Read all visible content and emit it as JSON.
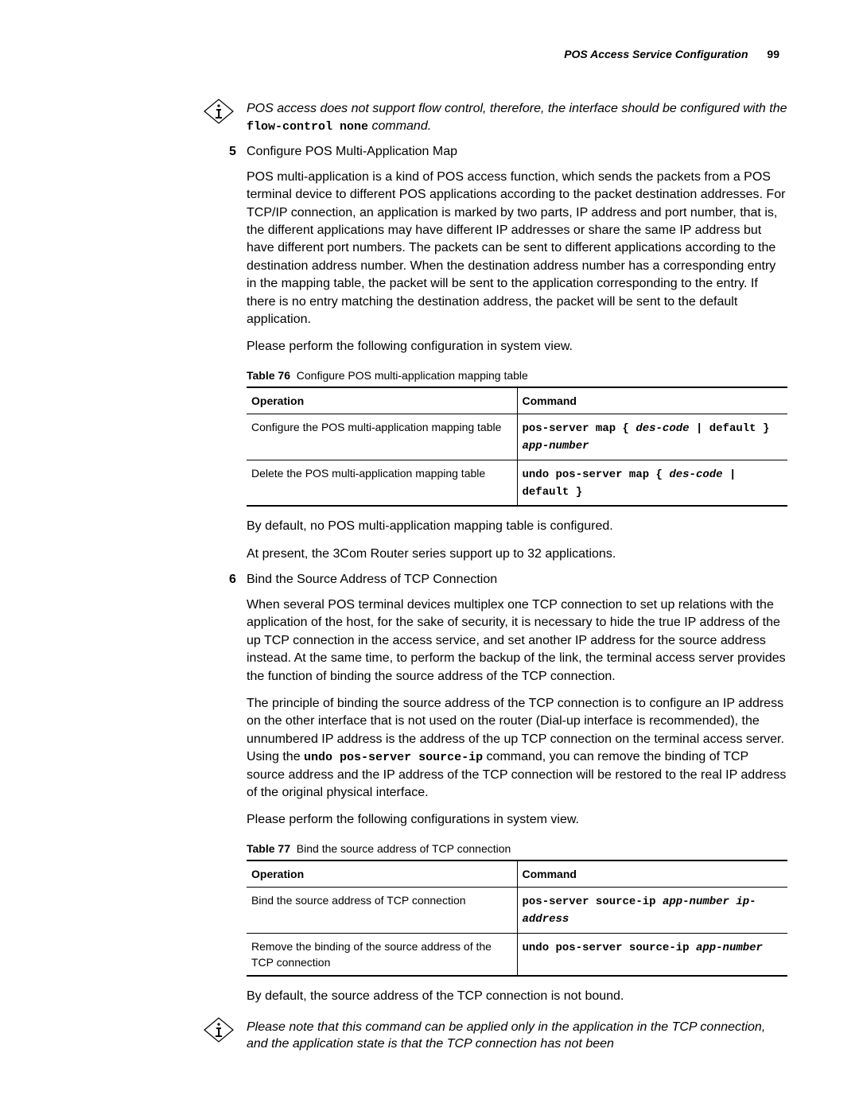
{
  "header": {
    "title": "POS Access Service Configuration",
    "page_number": "99"
  },
  "note1": {
    "prefix": "POS access does not support flow control, therefore, the interface should be configured with the ",
    "code": "flow-control none",
    "suffix": " command."
  },
  "step5": {
    "num": "5",
    "title": "Configure POS Multi-Application Map",
    "para1": "POS multi-application is a kind of POS access function, which sends the packets from a POS terminal device to different POS applications according to the packet destination addresses. For TCP/IP connection, an application is marked by two parts, IP address and port number, that is, the different applications may have different IP addresses or share the same IP address but have different port numbers. The packets can be sent to different applications according to the destination address number. When the destination address number has a corresponding entry in the mapping table, the packet will be sent to the application corresponding to the entry. If there is no entry matching the destination address, the packet will be sent to the default application.",
    "para2": "Please perform the following configuration in system view.",
    "tableCaptionLabel": "Table 76",
    "tableCaptionText": "Configure POS multi-application mapping table",
    "th1": "Operation",
    "th2": "Command",
    "row1_op": "Configure the POS multi-application mapping table",
    "row1_c1": "pos-server map { ",
    "row1_c2": "des-code",
    "row1_c3": " | default } ",
    "row1_c4": "app-number",
    "row2_op": "Delete the POS multi-application mapping table",
    "row2_c1": "undo pos-server map  { ",
    "row2_c2": "des-code",
    "row2_c3": " | default }",
    "after1": "By default, no POS multi-application mapping table is configured.",
    "after2": "At present, the 3Com Router series support up to 32 applications."
  },
  "step6": {
    "num": "6",
    "title": "Bind the Source Address of TCP Connection",
    "para1": "When several POS terminal devices multiplex one TCP connection to set up relations with the application of the host, for the sake of security, it is necessary to hide the true IP address of the up TCP connection in the access service, and set another IP address for the source address instead. At the same time, to perform the backup of the link, the terminal access server provides the function of binding the source address of the TCP connection.",
    "para2a": "The principle of binding the source address of the TCP connection is to configure an IP address on the other interface that is not used on the router (Dial-up interface is recommended), the unnumbered IP address is the address of the up TCP connection on the terminal access server. Using the ",
    "para2code": "undo pos-server source-ip",
    "para2b": " command, you can remove the binding of TCP source address and the IP address of the TCP connection will be restored to the real IP address of the original physical interface.",
    "para3": "Please perform the following configurations in system view.",
    "tableCaptionLabel": "Table 77",
    "tableCaptionText": "Bind the source address of TCP connection",
    "th1": "Operation",
    "th2": "Command",
    "row1_op": "Bind the source address of TCP connection",
    "row1_c1": "pos-server source-ip ",
    "row1_c2": "app-number ip-address",
    "row2_op": "Remove the binding of the source address of the TCP connection",
    "row2_c1": "undo pos-server source-ip ",
    "row2_c2": "app-number",
    "after1": "By default, the source address of the TCP connection is not bound."
  },
  "note2": {
    "text": "Please note that this command can be applied only in the application in the TCP connection, and the application state is that the TCP connection has not been"
  }
}
